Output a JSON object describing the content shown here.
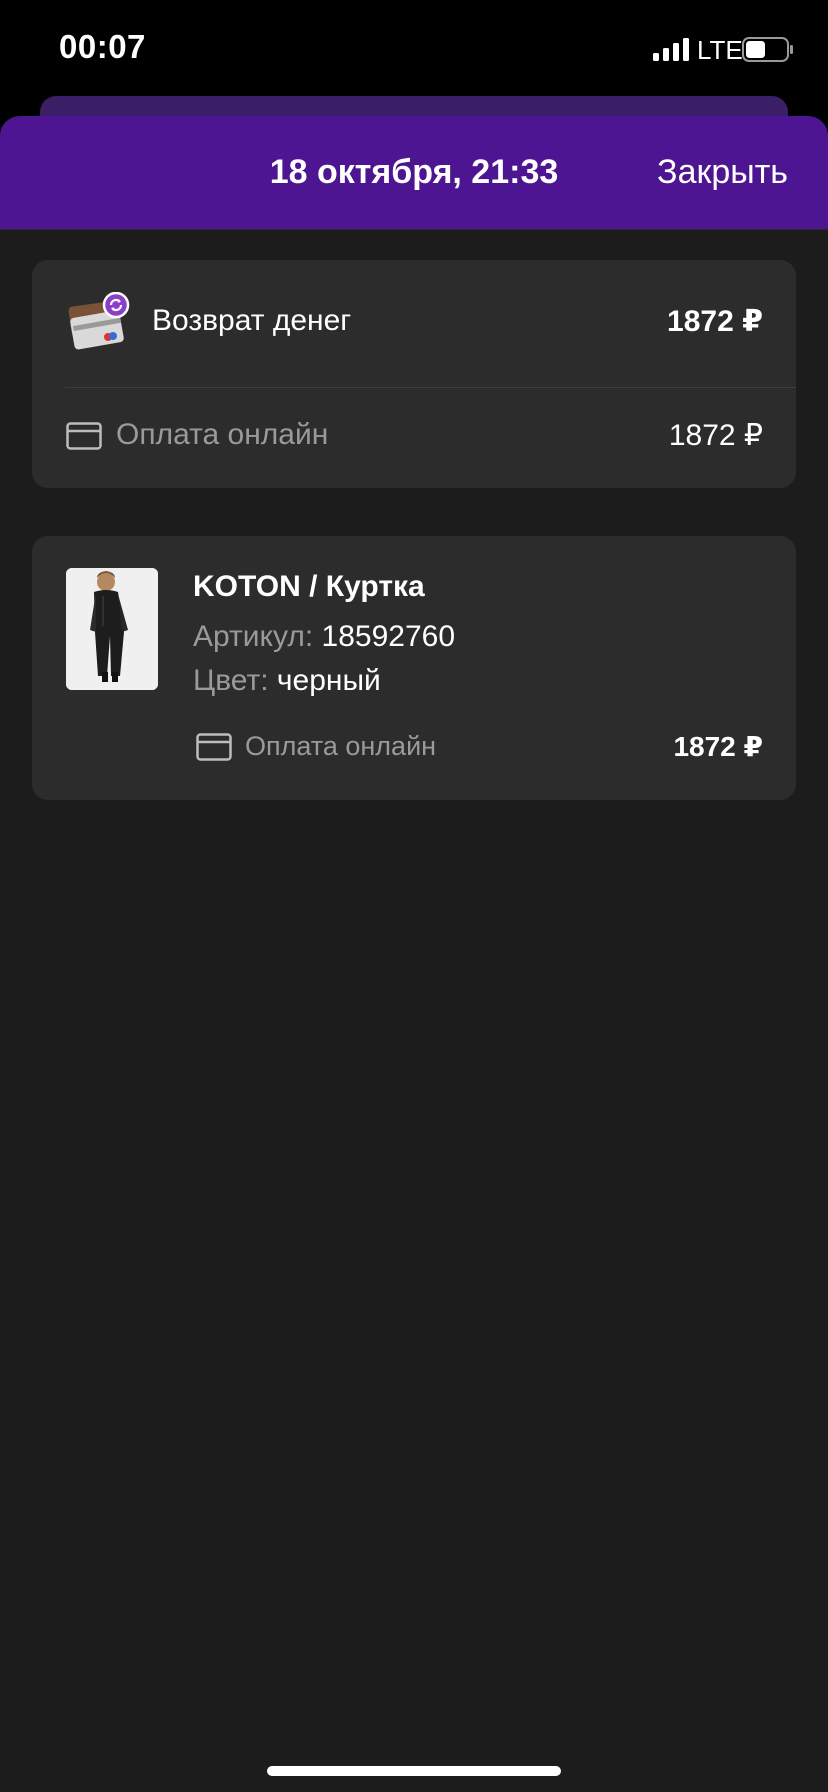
{
  "status_bar": {
    "time": "00:07",
    "network": "LTE"
  },
  "header": {
    "title": "18 октября, 21:33",
    "close_label": "Закрыть",
    "color": "#4e1593"
  },
  "refund": {
    "label": "Возврат денег",
    "amount": "1872 ₽",
    "payment_method": "Оплата онлайн",
    "payment_amount": "1872 ₽",
    "icon": "refund-card-icon"
  },
  "item": {
    "title": "KOTON / Куртка",
    "article_label": "Артикул:",
    "article_value": "18592760",
    "color_label": "Цвет:",
    "color_value": "черный",
    "payment_method": "Оплата онлайн",
    "payment_amount": "1872 ₽"
  }
}
